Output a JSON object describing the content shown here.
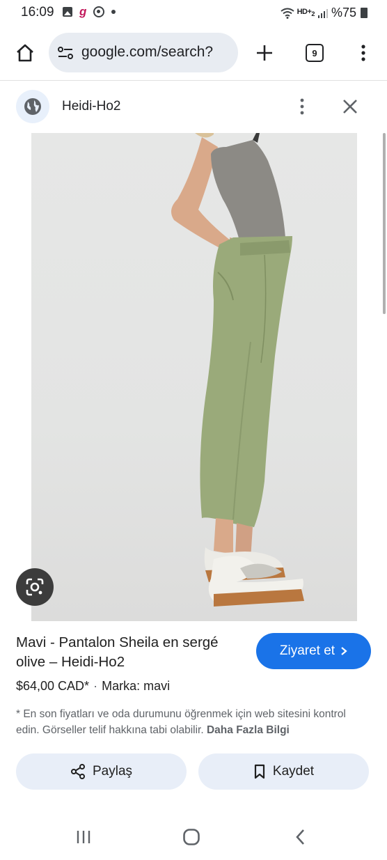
{
  "status_bar": {
    "time": "16:09",
    "network": "HD+",
    "network_sub": "2",
    "battery": "%75",
    "icons": [
      "gallery-icon",
      "g-app-icon",
      "sync-icon",
      "dot-icon",
      "wifi-icon",
      "signal-icon",
      "battery-icon"
    ]
  },
  "toolbar": {
    "url": "google.com/search?",
    "tab_count": "9",
    "icons": [
      "home-icon",
      "site-settings-icon",
      "plus-icon",
      "tabs-icon",
      "more-vert-icon"
    ]
  },
  "site_header": {
    "name": "Heidi-Ho2",
    "icons": [
      "globe-icon",
      "more-vert-icon",
      "close-icon"
    ]
  },
  "product": {
    "title": "Mavi - Pantalon Sheila en sergé olive – Heidi-Ho2",
    "price": "$64,00 CAD*",
    "separator": "·",
    "brand": "Marka: mavi",
    "disclaimer": "* En son fiyatları ve oda durumunu öğrenmek için web sitesini kontrol edin. Görseller telif hakkına tabi olabilir.",
    "more_info": "Daha Fazla Bilgi"
  },
  "actions": {
    "visit": "Ziyaret et",
    "share": "Paylaş",
    "save": "Kaydet"
  },
  "colors": {
    "accent": "#1a73e8",
    "pill_bg": "#e8eef8",
    "pants_olive": "#9aaa7a"
  }
}
